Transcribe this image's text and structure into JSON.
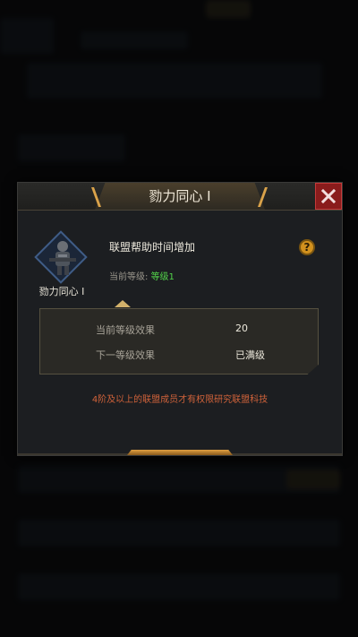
{
  "dialog": {
    "title": "勠力同心 I",
    "close_icon": "close-icon",
    "skill_icon": "soldier-badge-icon",
    "skill_icon_label": "勠力同心 I",
    "skill_name": "联盟帮助时间增加",
    "current_level_label": "当前等级:",
    "current_level_value": "等级1",
    "help_icon": "question-mark-icon",
    "effects": [
      {
        "label": "当前等级效果",
        "value": "20"
      },
      {
        "label": "下一等级效果",
        "value": "已满级"
      }
    ],
    "notice": "4阶及以上的联盟成员才有权限研究联盟科技"
  },
  "colors": {
    "accent": "#d9a24a",
    "level_green": "#52d34a",
    "notice": "#d0623a",
    "close_red": "#8a1c1c"
  }
}
